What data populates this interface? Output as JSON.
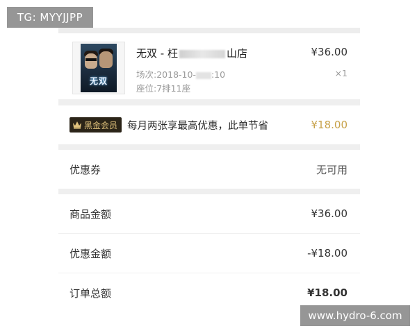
{
  "overlay": {
    "tag": "TG: MYYJJPP",
    "watermark": "www.hydro-6.com"
  },
  "order_item": {
    "poster_text": "无双",
    "title_prefix": "无双 - 枉",
    "title_suffix": "山店",
    "price": "¥36.00",
    "schedule_prefix": "场次:2018-10-",
    "schedule_suffix": ":10",
    "seat": "座位:7排11座",
    "quantity": "×1",
    "poster_icon": "movie-poster"
  },
  "membership": {
    "badge_label": "黑金会员",
    "badge_icon": "crown-icon",
    "promo_text": "每月两张享最高优惠，此单节省",
    "savings": "¥18.00",
    "savings_color": "#c8a24a"
  },
  "coupon": {
    "label": "优惠券",
    "value": "无可用"
  },
  "summary": {
    "rows": [
      {
        "label": "商品金额",
        "value": "¥36.00"
      },
      {
        "label": "优惠金额",
        "value": "-¥18.00"
      }
    ],
    "total_label": "订单总额",
    "total_value": "¥18.00",
    "total_color": "#e0442b"
  }
}
